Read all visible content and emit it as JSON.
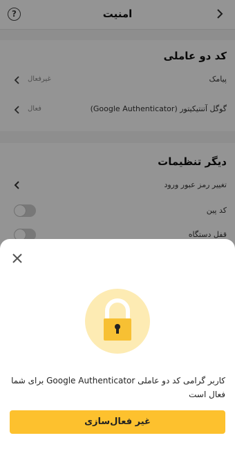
{
  "header": {
    "title": "امنیت",
    "help_icon": "question-circle-icon",
    "help_glyph": "?",
    "back_icon": "chevron-right-icon"
  },
  "two_factor": {
    "title": "کد دو عاملی",
    "items": [
      {
        "label": "پیامک",
        "status": "غیرفعال"
      },
      {
        "label": "گوگل آتنتیکیتور (Google Authenticator)",
        "status": "فعال"
      }
    ]
  },
  "other_settings": {
    "title": "دیگر تنظیمات",
    "items": [
      {
        "label": "تغییر رمز عبور ورود"
      },
      {
        "label": "کد پین",
        "toggle": false
      },
      {
        "label": "قفل دستگاه",
        "toggle": false
      }
    ]
  },
  "sheet": {
    "close_icon": "close-icon",
    "lock_icon": "lock-icon",
    "message": "کاربر گرامی کد دو عاملی Google Authenticator برای شما فعال است",
    "button_label": "غیر فعال‌سازی"
  },
  "colors": {
    "accent": "#fdc12e",
    "lock_bg": "#fdebb3",
    "lock_body": "#f7c033"
  }
}
